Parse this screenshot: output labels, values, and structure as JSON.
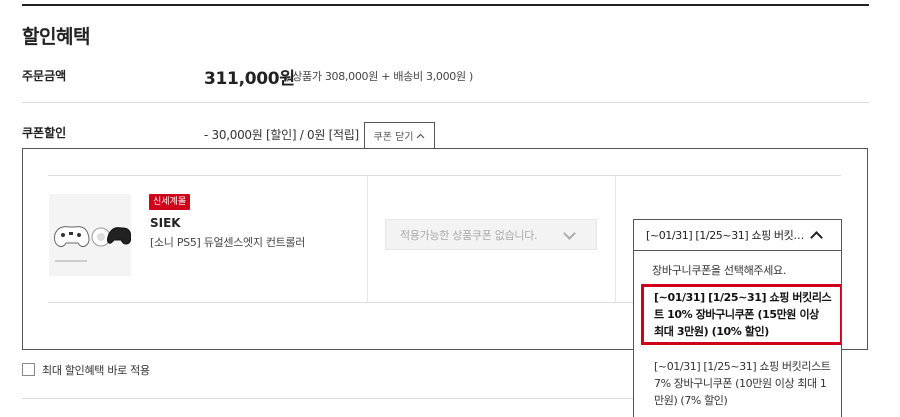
{
  "section_title": "할인혜택",
  "order_amount": {
    "label": "주문금액",
    "total": "311,000원",
    "detail": "( 상품가 308,000원 + 배송비 3,000원 )"
  },
  "coupon_discount": {
    "label": "쿠폰할인",
    "summary": "- 30,000원 [할인] / 0원 [적립]",
    "toggle_label": "쿠폰 닫기"
  },
  "product": {
    "badge": "신세계몰",
    "brand": "SIEK",
    "name": "[소니 PS5] 듀얼센스엣지 컨트롤러"
  },
  "product_coupon": {
    "placeholder": "적용가능한 상품쿠폰 없습니다."
  },
  "cart_coupon": {
    "selected_display": "[~01/31] [1/25~31] 쇼핑 버킷…",
    "placeholder": "장바구니쿠폰을 선택해주세요.",
    "options": [
      {
        "label": "[~01/31] [1/25~31] 쇼핑 버킷리스트 10% 장바구니쿠폰 (15만원 이상 최대 3만원) (10% 할인)"
      },
      {
        "label": "[~01/31] [1/25~31] 쇼핑 버킷리스트 7% 장바구니쿠폰 (10만원 이상 최대 1만원) (7% 할인)"
      }
    ]
  },
  "max_discount": {
    "label": "최대 할인혜택 바로 적용",
    "checked": false
  },
  "colors": {
    "accent": "#d0021b",
    "border": "#555555"
  }
}
